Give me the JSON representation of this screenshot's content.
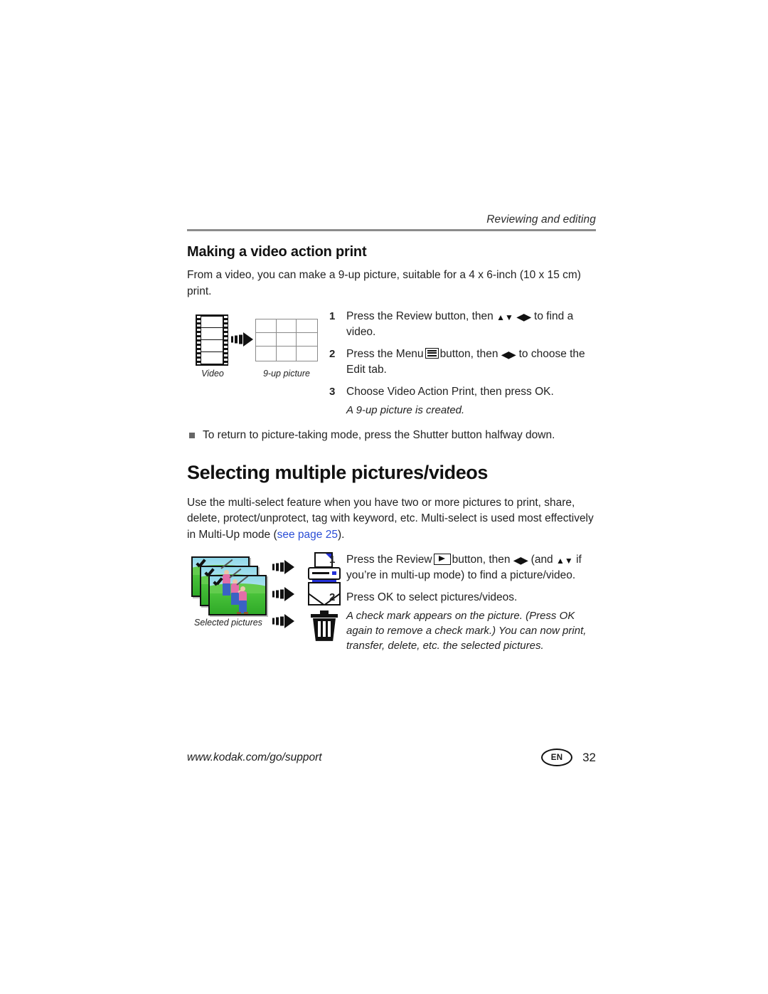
{
  "header": {
    "running_head": "Reviewing and editing"
  },
  "section_video_print": {
    "heading": "Making a video action print",
    "intro": "From a video, you can make a 9-up picture, suitable for a 4 x 6-inch (10 x 15 cm) print.",
    "figure": {
      "source_caption": "Video",
      "result_caption": "9-up picture",
      "arrow_icon": "motion-arrow-icon",
      "film_icon": "film-strip-icon",
      "grid_icon": "nine-up-grid-icon"
    },
    "steps": [
      {
        "num": "1",
        "text_before": "Press the Review button, then",
        "glyph_updown": "▲▼",
        "glyph_leftright": "◀▶",
        "text_after": "to find a video."
      },
      {
        "num": "2",
        "text_before": "Press the Menu",
        "icon": "menu-icon",
        "text_mid": "button, then",
        "glyph_leftright": "◀▶",
        "text_after": "to choose the Edit tab."
      },
      {
        "num": "3",
        "text": "Choose Video Action Print, then press OK.",
        "note": "A 9-up picture is created."
      }
    ],
    "bullet": "To return to picture-taking mode, press the Shutter button halfway down."
  },
  "section_multiselect": {
    "heading": "Selecting multiple pictures/videos",
    "intro_part1": "Use the multi-select feature when you have two or more pictures to print, share, delete, protect/unprotect, tag with keyword, etc. Multi-select is used most effectively in Multi-Up mode (",
    "link_text": "see page 25",
    "link_color": "#2b4ed6",
    "intro_part2": ").",
    "figure": {
      "caption": "Selected pictures",
      "photo_icon": "selected-picture-thumbnail",
      "check_icon": "check-mark-icon",
      "printer_icon": "printer-icon",
      "envelope_icon": "envelope-icon",
      "trash_icon": "trash-can-icon",
      "arrow_icon": "motion-arrow-icon"
    },
    "steps": [
      {
        "num": "1",
        "text_before": "Press the Review",
        "icon": "review-play-icon",
        "text_mid": "button, then",
        "glyph_leftright": "◀▶",
        "text_paren": "(and",
        "glyph_updown": "▲▼",
        "text_after": "if you’re in multi-up mode) to find a picture/video."
      },
      {
        "num": "2",
        "text": "Press OK to select pictures/videos.",
        "note": "A check mark appears on the picture. (Press OK again to remove a check mark.) You can now print, transfer, delete, etc. the selected pictures."
      }
    ]
  },
  "footer": {
    "url": "www.kodak.com/go/support",
    "language_badge": "EN",
    "page_number": "32"
  }
}
